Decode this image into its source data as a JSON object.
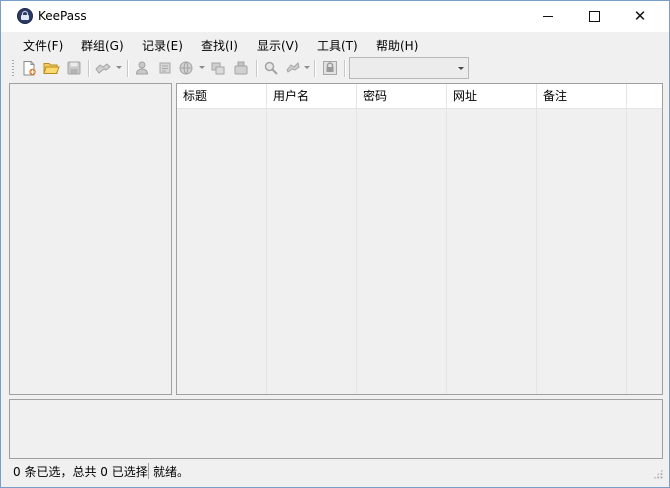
{
  "window": {
    "title": "KeePass",
    "icon": "keepass-lock-icon"
  },
  "menu": [
    {
      "label": "文件(F)"
    },
    {
      "label": "群组(G)"
    },
    {
      "label": "记录(E)"
    },
    {
      "label": "查找(I)"
    },
    {
      "label": "显示(V)"
    },
    {
      "label": "工具(T)"
    },
    {
      "label": "帮助(H)"
    }
  ],
  "toolbar": {
    "buttons": [
      {
        "icon": "new-database-icon",
        "enabled": true
      },
      {
        "icon": "open-folder-icon",
        "enabled": true
      },
      {
        "icon": "save-icon",
        "enabled": false
      },
      {
        "icon": "add-entry-icon",
        "enabled": false
      },
      {
        "icon": "copy-username-icon",
        "enabled": false
      },
      {
        "icon": "copy-password-icon",
        "enabled": false
      },
      {
        "icon": "open-url-icon",
        "enabled": false
      },
      {
        "icon": "auto-type-icon",
        "enabled": false
      },
      {
        "icon": "find-icon",
        "enabled": false
      },
      {
        "icon": "show-entries-icon",
        "enabled": false
      },
      {
        "icon": "lock-workspace-icon",
        "enabled": false
      }
    ],
    "quick_find_value": ""
  },
  "entry_list": {
    "columns": [
      "标题",
      "用户名",
      "密码",
      "网址",
      "备注"
    ]
  },
  "status": {
    "selection": "0 条已选，总共 0 已选择",
    "ready": "就绪。"
  },
  "colors": {
    "window_border": "#7a9fc6",
    "chrome_bg": "#f0f0f0",
    "title_bg": "#ffffff",
    "pane_border": "#a0a0a0",
    "open_folder": "#e8b339",
    "new_db_accent": "#e07a2e"
  }
}
